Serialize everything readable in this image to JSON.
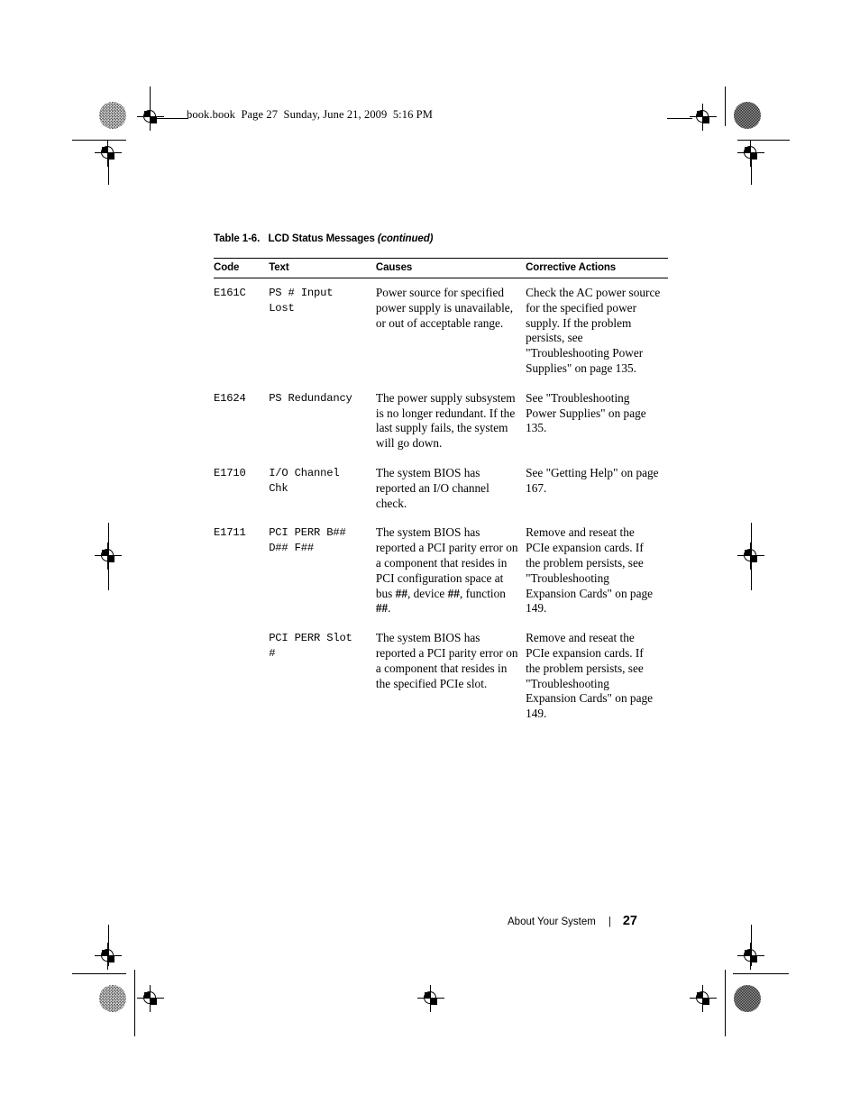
{
  "running_header": "book.book  Page 27  Sunday, June 21, 2009  5:16 PM",
  "table": {
    "title_label": "Table 1-6.",
    "title_text": "LCD Status Messages",
    "title_continued": "(continued)",
    "columns": [
      "Code",
      "Text",
      "Causes",
      "Corrective Actions"
    ],
    "rows": [
      {
        "code": "E161C",
        "text": "PS # Input\nLost",
        "causes": "Power source for specified power supply is unavailable, or out of acceptable range.",
        "actions": "Check the AC power source for the specified power supply. If the problem persists, see \"Troubleshooting Power Supplies\" on page 135."
      },
      {
        "code": "E1624",
        "text": "PS Redundancy",
        "causes": "The power supply subsystem is no longer redundant. If the last supply fails, the system will go down.",
        "actions": "See \"Troubleshooting Power Supplies\" on page 135."
      },
      {
        "code": "E1710",
        "text": "I/O Channel\nChk",
        "causes": "The system BIOS has reported an I/O channel check.",
        "actions": "See \"Getting Help\" on page 167."
      },
      {
        "code": "E1711",
        "text": "PCI PERR B##\nD## F##",
        "causes_pre": "The system BIOS has reported a PCI parity error on a component that resides in PCI configuration space at bus ",
        "causes_h1": "##",
        "causes_mid1": ", device ",
        "causes_h2": "##",
        "causes_mid2": ", function ",
        "causes_h3": "##",
        "causes_post": ".",
        "actions": "Remove and reseat the PCIe expansion cards. If the problem persists, see \"Troubleshooting Expansion Cards\" on page 149."
      },
      {
        "code": "",
        "text": "PCI PERR Slot\n#",
        "causes": "The system BIOS has reported a PCI parity error on a component that resides in the specified PCIe slot.",
        "actions": "Remove and reseat the PCIe expansion cards. If the problem persists, see \"Troubleshooting Expansion Cards\" on page 149."
      }
    ]
  },
  "footer": {
    "chapter": "About Your System",
    "separator": "|",
    "page_number": "27"
  }
}
